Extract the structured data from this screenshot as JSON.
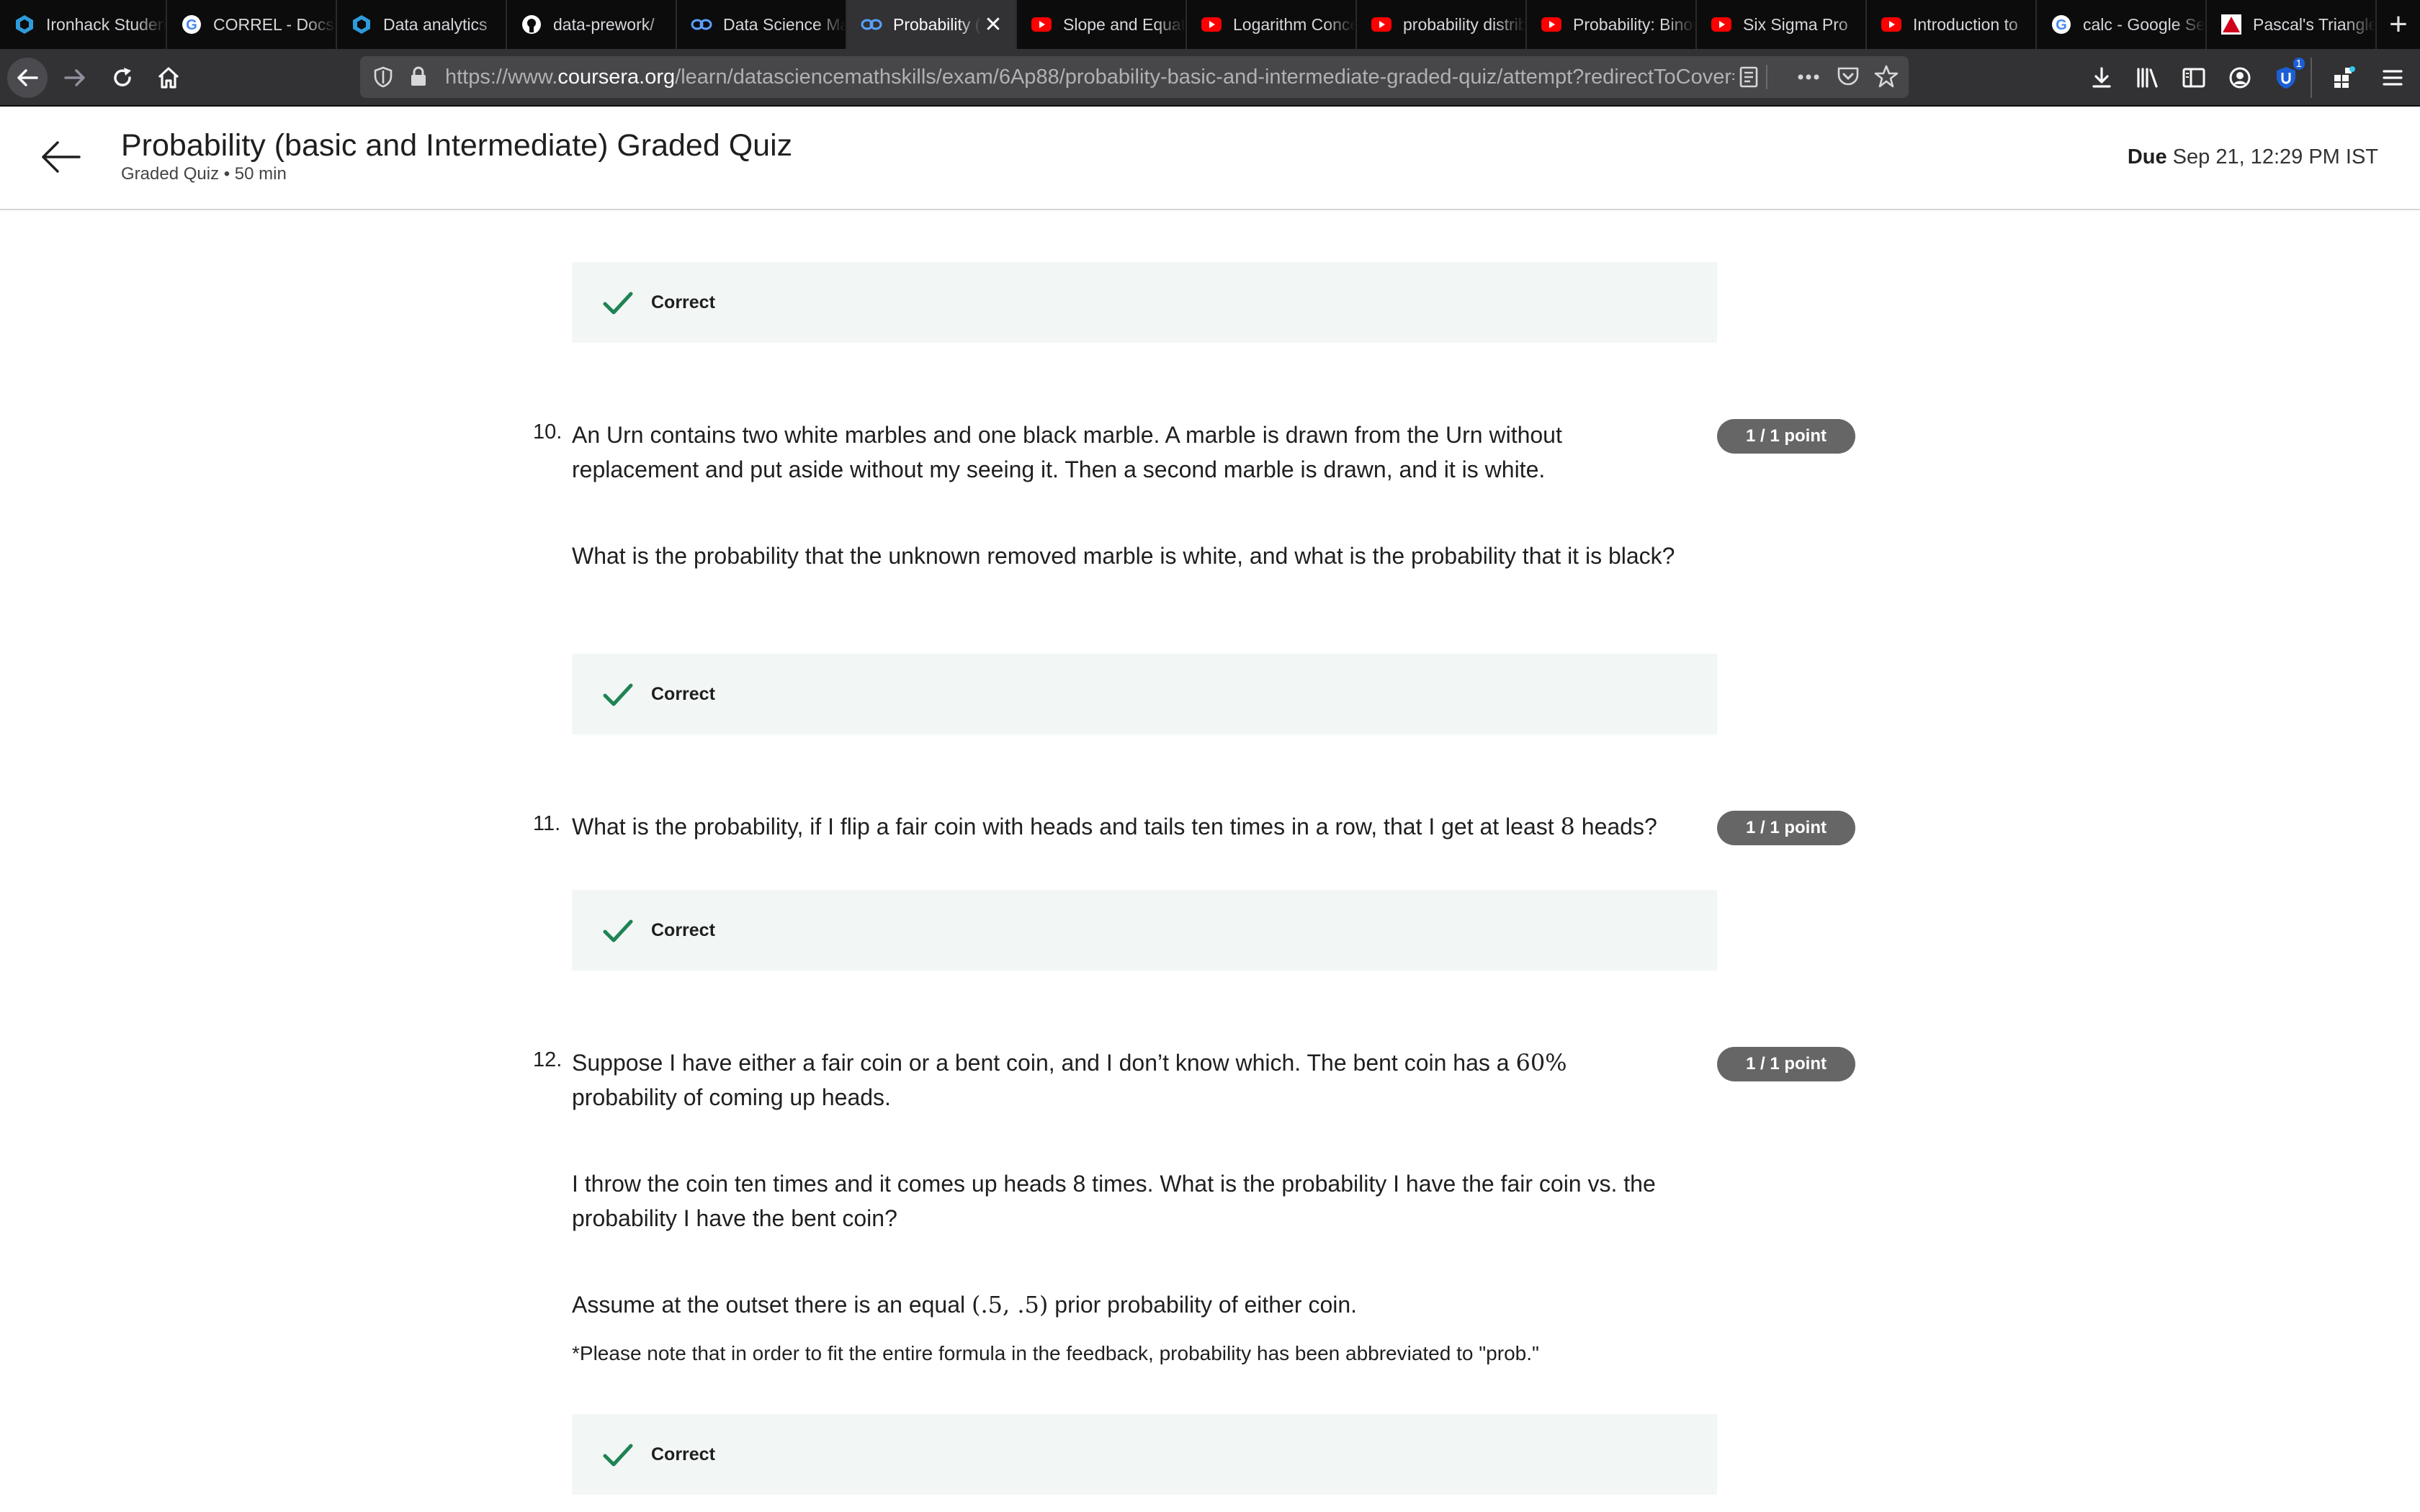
{
  "browser": {
    "tabs": [
      {
        "label": "Ironhack Student Portal",
        "icon": "ironhack-icon"
      },
      {
        "label": "CORREL - Docs Editors Help",
        "icon": "google-icon"
      },
      {
        "label": "Data analytics",
        "icon": "ironhack-icon"
      },
      {
        "label": "data-prework/",
        "icon": "github-icon"
      },
      {
        "label": "Data Science Math Skills",
        "icon": "coursera-icon"
      },
      {
        "label": "Probability (basic",
        "icon": "coursera-icon",
        "active": true
      },
      {
        "label": "Slope and Equation",
        "icon": "youtube-icon"
      },
      {
        "label": "Logarithm Concept",
        "icon": "youtube-icon"
      },
      {
        "label": "probability distribution",
        "icon": "youtube-icon"
      },
      {
        "label": "Probability: Binomial",
        "icon": "youtube-icon"
      },
      {
        "label": "Six Sigma Pro",
        "icon": "youtube-icon"
      },
      {
        "label": "Introduction to",
        "icon": "youtube-icon"
      },
      {
        "label": "calc - Google Search",
        "icon": "google-icon"
      },
      {
        "label": "Pascal's Triangle",
        "icon": "pascal-icon"
      }
    ],
    "url_prefix": "https://www.",
    "url_domain": "coursera.org",
    "url_path": "/learn/datasciencemathskills/exam/6Ap88/probability-basic-and-intermediate-graded-quiz/attempt?redirectToCover=true",
    "extension_badge": "1"
  },
  "header": {
    "title": "Probability (basic and Intermediate) Graded Quiz",
    "subtitle": "Graded Quiz • 50 min",
    "due_label": "Due",
    "due_value": "Sep 21, 12:29 PM IST"
  },
  "quiz": {
    "feedback_label": "Correct",
    "points_label": "1 / 1 point",
    "q10": {
      "number": "10.",
      "p1": "An Urn contains two white marbles and one black marble. A marble is drawn from the Urn without replacement and put aside without my seeing it. Then a second marble is drawn, and it is white.",
      "p2": "What is the probability that the unknown removed marble is white, and what is the probability that it is black?"
    },
    "q11": {
      "number": "11.",
      "p1_a": "What is the probability, if I flip a fair coin with heads and tails ten times in a row, that I get at least ",
      "p1_math": "8",
      "p1_b": " heads?"
    },
    "q12": {
      "number": "12.",
      "p1_a": "Suppose I have either a fair coin or a bent coin, and I don’t know which. The bent coin has a ",
      "p1_math": "60%",
      "p1_b": " probability of coming up heads.",
      "p2": "I throw the coin ten times and it comes up heads 8 times. What is the probability I have the fair coin vs. the probability I have the bent coin?",
      "p3_a": "Assume at the outset there is an equal ",
      "p3_math": "(.5, .5)",
      "p3_b": " prior probability of either coin.",
      "note": "*Please note that in order to fit the entire formula in the feedback, probability has been abbreviated to \"prob.\""
    }
  }
}
